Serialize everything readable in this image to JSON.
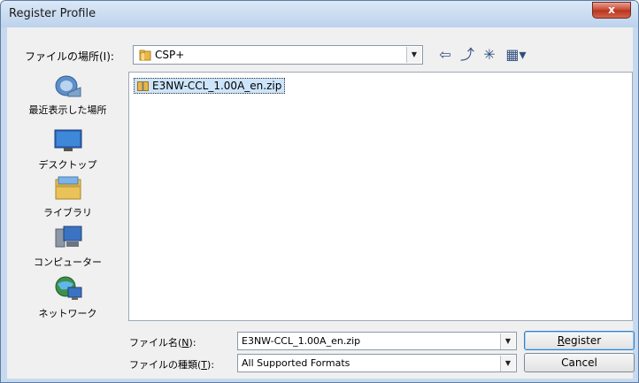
{
  "window": {
    "title": "Register Profile",
    "close_glyph": "x"
  },
  "lookin": {
    "label": "ファイルの場所(I):",
    "value": "CSP+"
  },
  "toolbar": {
    "back_glyph": "⇦",
    "up_glyph": "⤴",
    "new_glyph": "✳",
    "view_glyph": "▦▾"
  },
  "places": [
    {
      "label": "最近表示した場所",
      "icon": "recent-places-icon"
    },
    {
      "label": "デスクトップ",
      "icon": "desktop-icon"
    },
    {
      "label": "ライブラリ",
      "icon": "libraries-icon"
    },
    {
      "label": "コンピューター",
      "icon": "computer-icon"
    },
    {
      "label": "ネットワーク",
      "icon": "network-icon"
    }
  ],
  "files": [
    {
      "name": "E3NW-CCL_1.00A_en.zip"
    }
  ],
  "filename": {
    "label": "ファイル名(",
    "key": "N",
    "label_end": "):",
    "value": "E3NW-CCL_1.00A_en.zip"
  },
  "filetype": {
    "label": "ファイルの種類(",
    "key": "T",
    "label_end": "):",
    "value": "All Supported Formats"
  },
  "buttons": {
    "register": {
      "first": "R",
      "rest": "egister"
    },
    "cancel": "Cancel"
  },
  "colors": {
    "title_bg": "#c7d9ee",
    "close_red": "#c4452e",
    "selection": "#cde5fb"
  }
}
